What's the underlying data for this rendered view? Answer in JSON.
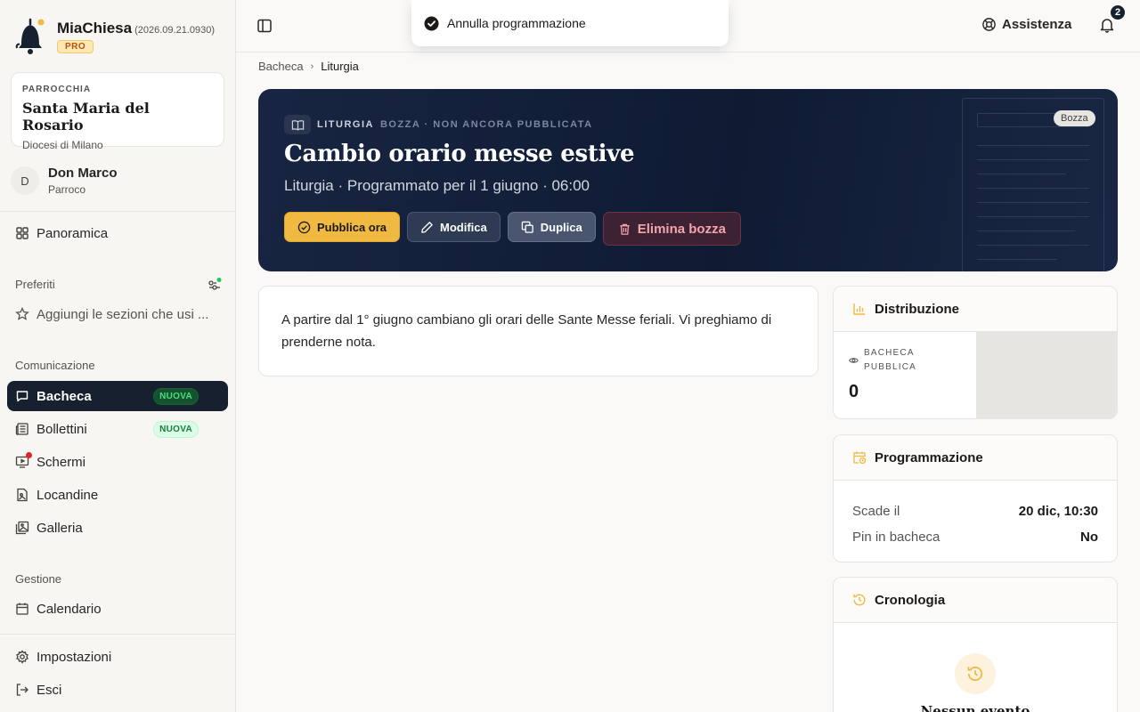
{
  "brand": {
    "name": "MiaChiesa",
    "version": "(2026.09.21.0930)",
    "plan": "PRO"
  },
  "parish": {
    "eyebrow": "PARROCCHIA",
    "name": "Santa Maria del Rosario",
    "diocese": "Diocesi di Milano"
  },
  "user": {
    "initial": "D",
    "name": "Don Marco",
    "role": "Parroco"
  },
  "nav": {
    "overview": "Panoramica",
    "favorites_label": "Preferiti",
    "favorites_add": "Aggiungi le sezioni che usi ...",
    "communication_label": "Comunicazione",
    "bacheca": "Bacheca",
    "bacheca_badge": "NUOVA",
    "bollettini": "Bollettini",
    "bollettini_badge": "NUOVA",
    "schermi": "Schermi",
    "locandine": "Locandine",
    "galleria": "Galleria",
    "management_label": "Gestione",
    "calendario": "Calendario",
    "impostazioni": "Impostazioni",
    "esci": "Esci"
  },
  "topbar": {
    "help": "Assistenza",
    "notifications_count": "2"
  },
  "toast": {
    "message": "Annulla programmazione"
  },
  "breadcrumb": {
    "root": "Bacheca",
    "current": "Liturgia"
  },
  "hero": {
    "category": "LITURGIA",
    "status": "BOZZA · NON ANCORA PUBBLICATA",
    "draft_pill": "Bozza",
    "title": "Cambio orario messe estive",
    "subtitle": "Liturgia · Programmato per il 1 giugno · 06:00",
    "actions": {
      "publish": "Pubblica ora",
      "edit": "Modifica",
      "duplicate": "Duplica",
      "delete": "Elimina bozza"
    }
  },
  "post": {
    "body": "A partire dal 1° giugno cambiano gli orari delle Sante Messe feriali. Vi preghiamo di prenderne nota."
  },
  "distribution": {
    "title": "Distribuzione",
    "stat_label": "BACHECA PUBBLICA",
    "stat_value": "0"
  },
  "schedule": {
    "title": "Programmazione",
    "expires_label": "Scade il",
    "expires_value": "20 dic, 10:30",
    "pin_label": "Pin in bacheca",
    "pin_value": "No"
  },
  "history": {
    "title": "Cronologia",
    "empty": "Nessun evento"
  },
  "colors": {
    "accent": "#f0b942",
    "hero_bg": "#0f1b33",
    "active_nav": "#17202f",
    "success": "#16a34a",
    "danger": "#dc2626"
  }
}
